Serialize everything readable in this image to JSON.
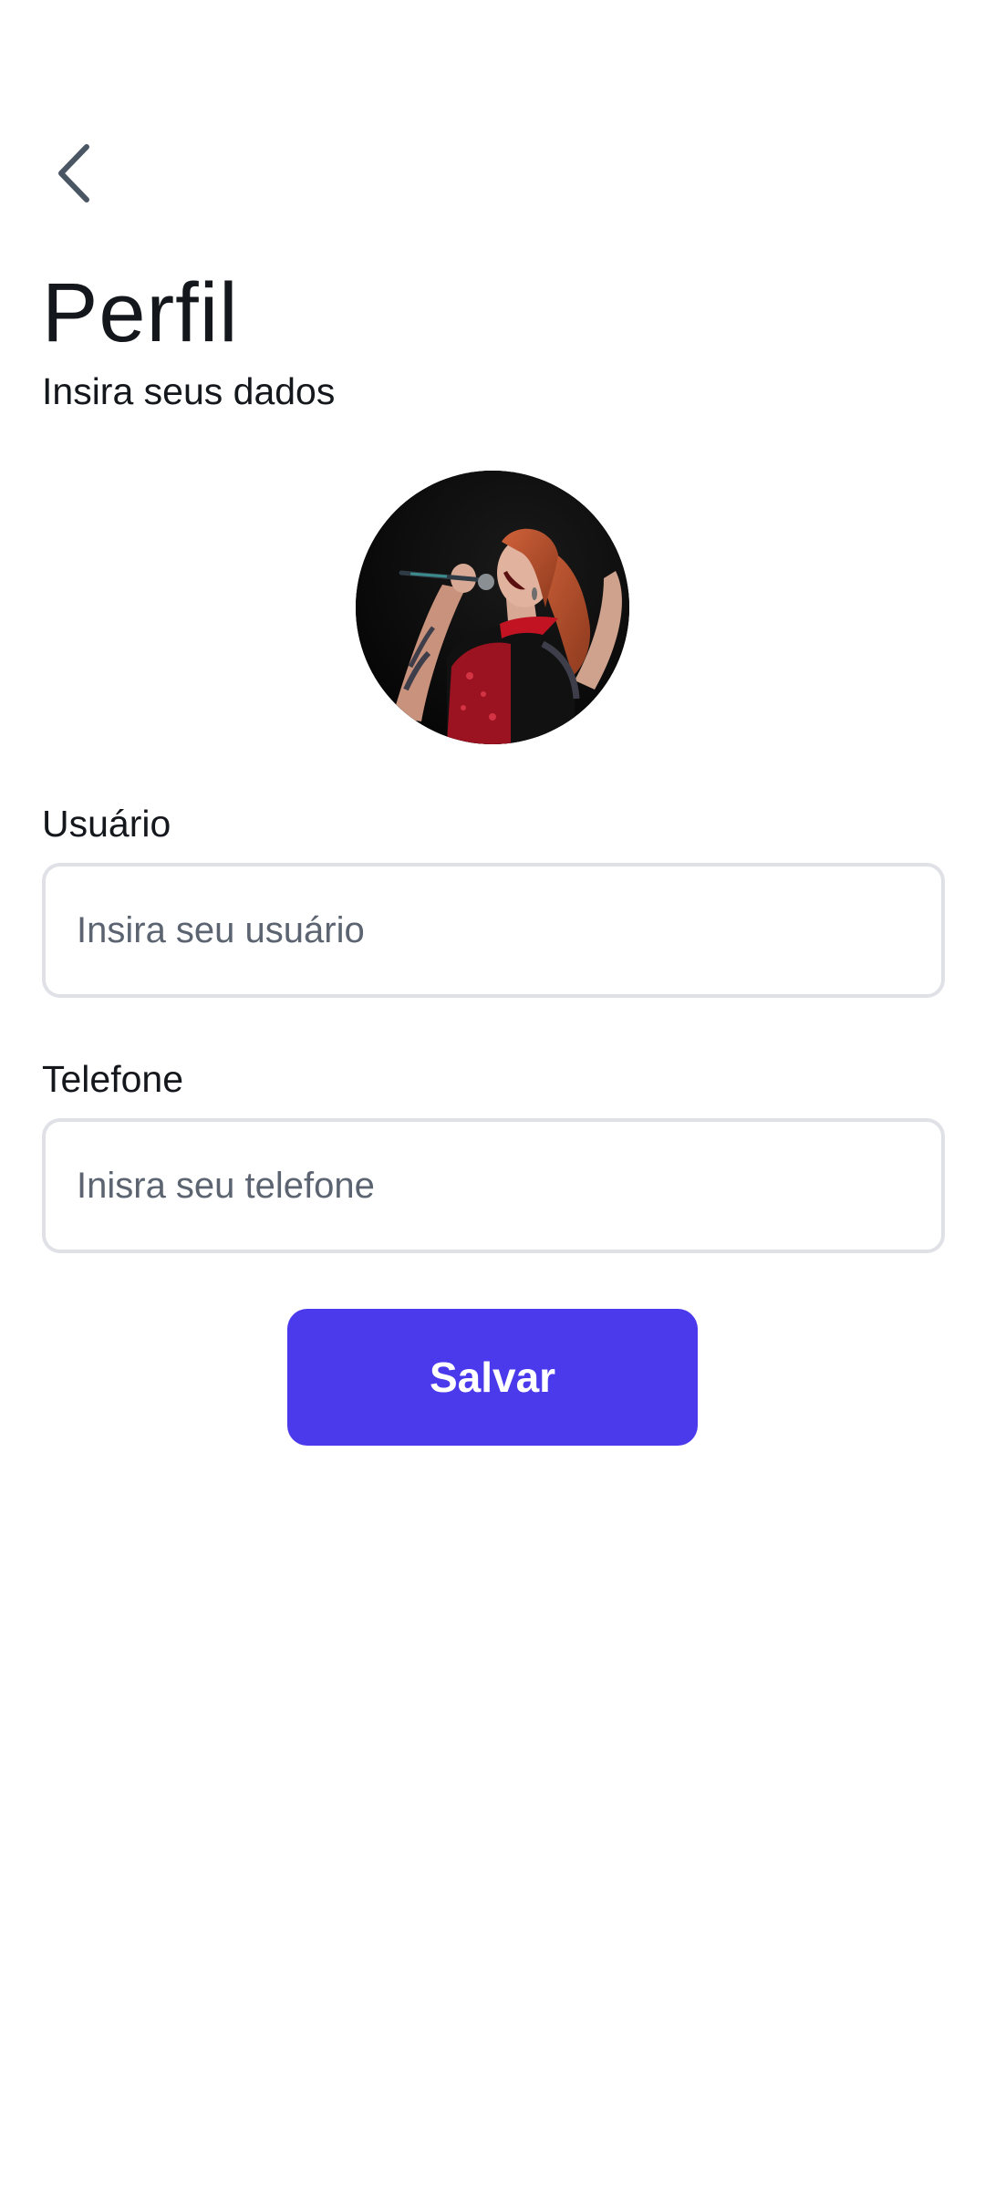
{
  "header": {
    "back_icon": "chevron-left-icon",
    "title": "Perfil",
    "subtitle": "Insira seus dados"
  },
  "avatar": {
    "description_icon": "profile-photo"
  },
  "form": {
    "username": {
      "label": "Usuário",
      "value": "",
      "placeholder": "Insira seu usuário"
    },
    "phone": {
      "label": "Telefone",
      "value": "",
      "placeholder": "Inisra seu telefone"
    },
    "save_label": "Salvar"
  },
  "colors": {
    "accent": "#4b3aeb",
    "text": "#14171c",
    "placeholder": "#5b6470",
    "input_border": "#dfe1e6",
    "icon": "#4a5663",
    "background": "#ffffff"
  }
}
